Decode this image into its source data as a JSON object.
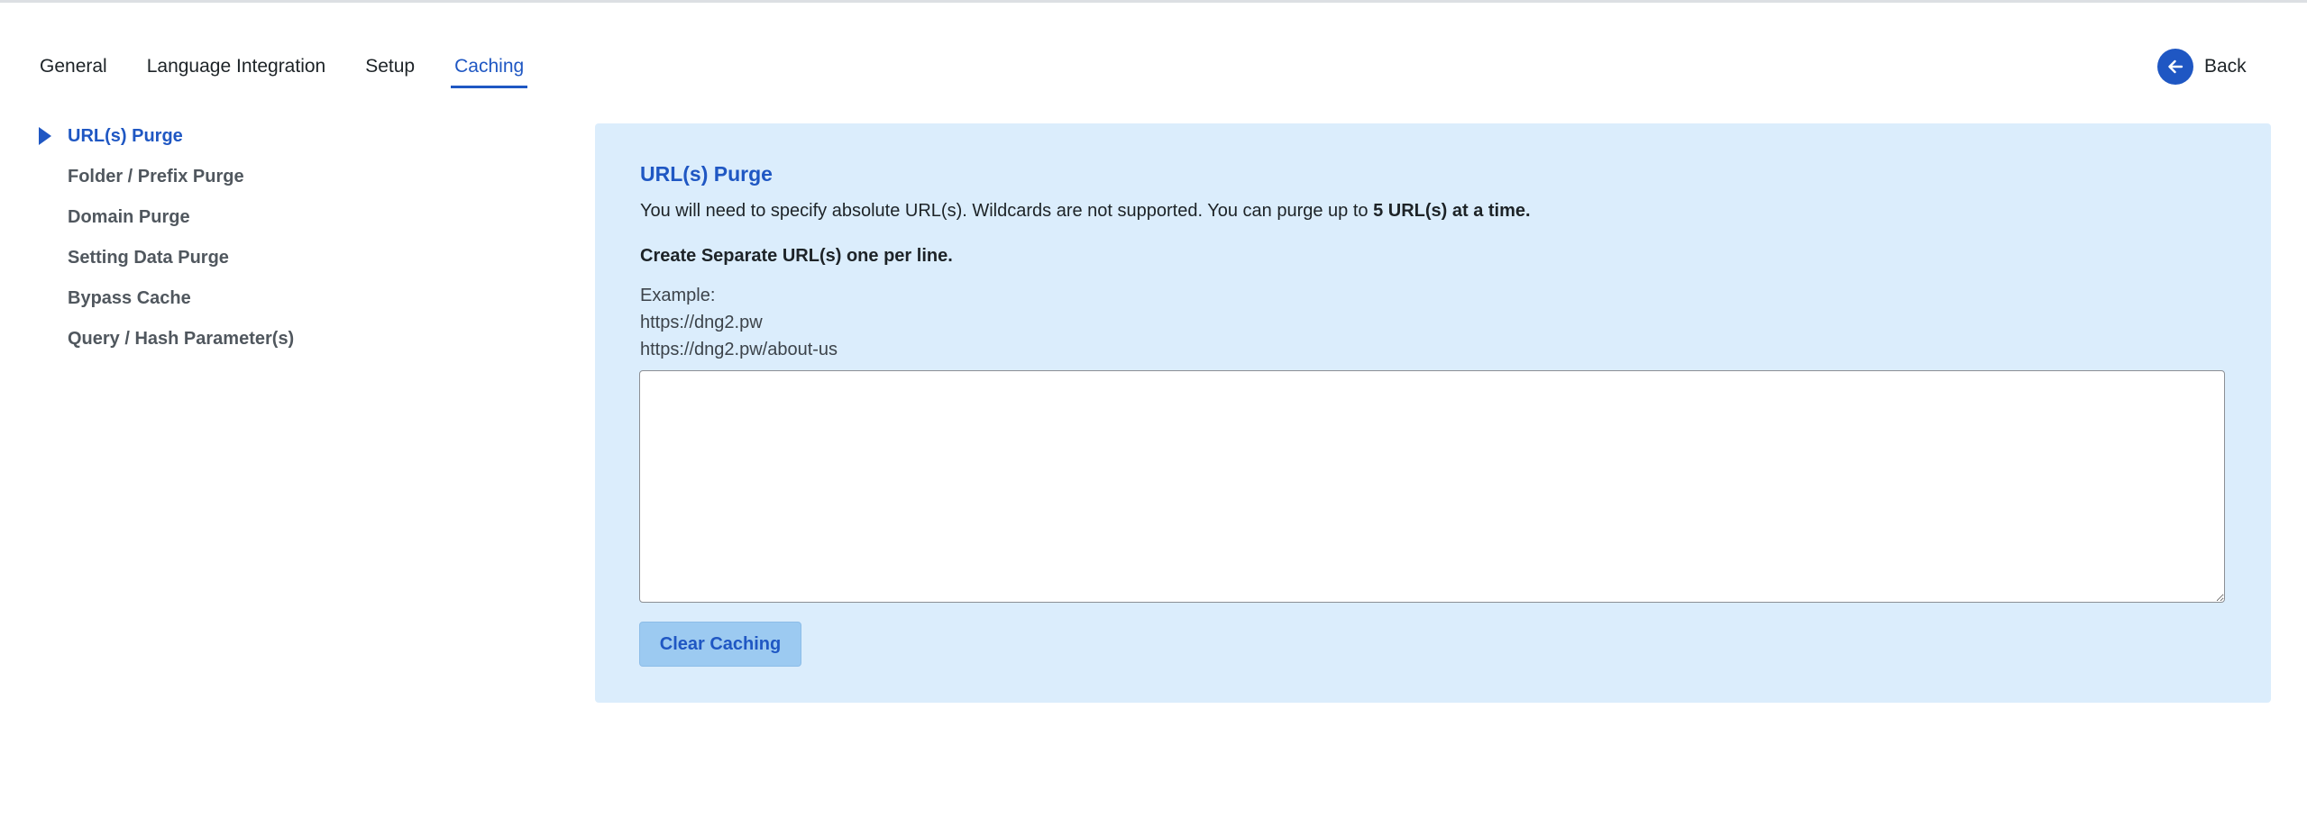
{
  "tabs": [
    {
      "label": "General",
      "active": false
    },
    {
      "label": "Language Integration",
      "active": false
    },
    {
      "label": "Setup",
      "active": false
    },
    {
      "label": "Caching",
      "active": true
    }
  ],
  "back": {
    "label": "Back",
    "icon": "arrow-left-icon"
  },
  "sidebar": {
    "items": [
      {
        "label": "URL(s) Purge",
        "active": true
      },
      {
        "label": "Folder / Prefix Purge",
        "active": false
      },
      {
        "label": "Domain Purge",
        "active": false
      },
      {
        "label": "Setting Data Purge",
        "active": false
      },
      {
        "label": "Bypass Cache",
        "active": false
      },
      {
        "label": "Query / Hash Parameter(s)",
        "active": false
      }
    ]
  },
  "panel": {
    "title": "URL(s) Purge",
    "description": "You will need to specify absolute URL(s). Wildcards are not supported. You can purge up to ",
    "description_bold": "5 URL(s) at a time.",
    "instruction": "Create Separate URL(s) one per line.",
    "example_label": "Example:",
    "example_lines": [
      "https://dng2.pw",
      "https://dng2.pw/about-us"
    ],
    "textarea_value": "",
    "button_label": "Clear Caching"
  },
  "colors": {
    "accent": "#1f57c3",
    "panel_bg": "#dbedfc",
    "button_bg": "#9ccaf1"
  }
}
